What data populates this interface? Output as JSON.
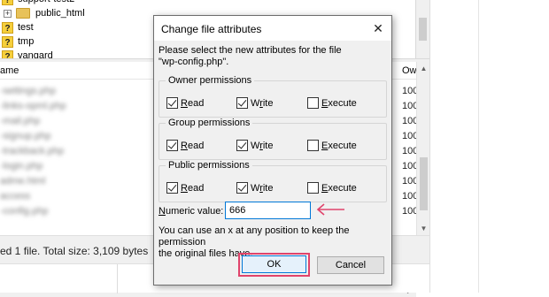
{
  "tree": {
    "items": [
      {
        "label": "support-test2",
        "kind": "folder-partial"
      },
      {
        "label": "public_html",
        "kind": "folder"
      },
      {
        "label": "test",
        "kind": "unknown"
      },
      {
        "label": "tmp",
        "kind": "unknown"
      },
      {
        "label": "vangard",
        "kind": "unknown"
      }
    ]
  },
  "filelist": {
    "col_name": "ame",
    "col_owner": "Ow",
    "rows": [
      {
        "name": "-settings.php",
        "owner": "100"
      },
      {
        "name": "-links-opml.php",
        "owner": "100"
      },
      {
        "name": "-mail.php",
        "owner": "100"
      },
      {
        "name": "-signup.php",
        "owner": "100"
      },
      {
        "name": "-trackback.php",
        "owner": "100"
      },
      {
        "name": "-login.php",
        "owner": "100"
      },
      {
        "name": "adme.html",
        "owner": "100"
      },
      {
        "name": "access",
        "owner": "100"
      },
      {
        "name": "-config.php",
        "owner": "100"
      }
    ]
  },
  "statusbar": {
    "text": "ed 1 file. Total size: 3,109 bytes"
  },
  "dialog": {
    "title": "Change file attributes",
    "close_glyph": "✕",
    "intro_line1": "Please select the new attributes for the file",
    "intro_line2": "\"wp-config.php\".",
    "groups": [
      {
        "legend": "Owner permissions",
        "read": true,
        "write": true,
        "execute": false
      },
      {
        "legend": "Group permissions",
        "read": true,
        "write": true,
        "execute": false
      },
      {
        "legend": "Public permissions",
        "read": true,
        "write": true,
        "execute": false
      }
    ],
    "labels": {
      "read_u": "R",
      "read_rest": "ead",
      "write_pre": "W",
      "write_u": "r",
      "write_rest": "ite",
      "exec_u": "E",
      "exec_rest": "xecute"
    },
    "numeric_label_pre": "N",
    "numeric_label_rest": "umeric value:",
    "numeric_value": "666",
    "hint_line1": "You can use an x at any position to keep the permission",
    "hint_line2": "the original files have.",
    "ok_label": "OK",
    "cancel_label": "Cancel"
  },
  "colors": {
    "annotation": "#e0436b",
    "focus_blue": "#0078d7",
    "dialog_bg": "#f0f0f0"
  },
  "icons": {
    "unknown_file": "question-mark-icon",
    "folder": "folder-icon",
    "expand": "expand-plus-icon",
    "close": "close-icon",
    "annotation_arrow": "arrow-left-icon"
  }
}
